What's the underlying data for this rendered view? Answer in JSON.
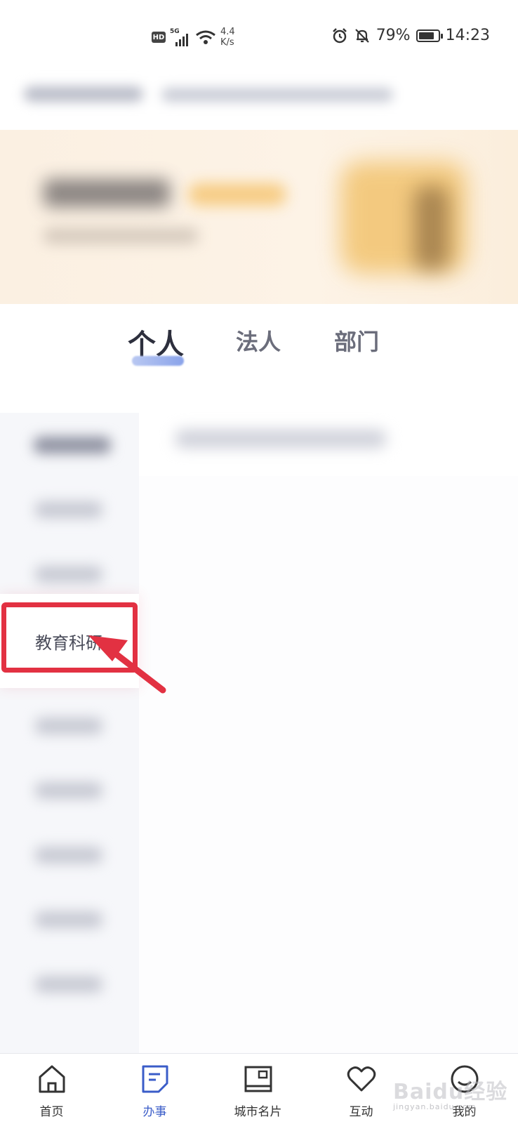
{
  "status_bar": {
    "hd": "HD",
    "network": "5G",
    "speed_value": "4.4",
    "speed_unit": "K/s",
    "battery_percent": "79%",
    "battery_level": 0.79,
    "time": "14:23"
  },
  "tabs": [
    {
      "label": "个人",
      "active": true
    },
    {
      "label": "法人",
      "active": false
    },
    {
      "label": "部门",
      "active": false
    }
  ],
  "sidebar": {
    "highlighted_item": "教育科研"
  },
  "bottom_nav": [
    {
      "label": "首页",
      "icon": "home-icon",
      "active": false
    },
    {
      "label": "办事",
      "icon": "task-icon",
      "active": true
    },
    {
      "label": "城市名片",
      "icon": "city-card-icon",
      "active": false
    },
    {
      "label": "互动",
      "icon": "heart-icon",
      "active": false
    },
    {
      "label": "我的",
      "icon": "profile-icon",
      "active": false
    }
  ],
  "watermark": {
    "text": "Baidu经验",
    "sub": "jingyan.baidu.com"
  },
  "colors": {
    "accent": "#3a5cc8",
    "highlight_box": "#e23142"
  }
}
